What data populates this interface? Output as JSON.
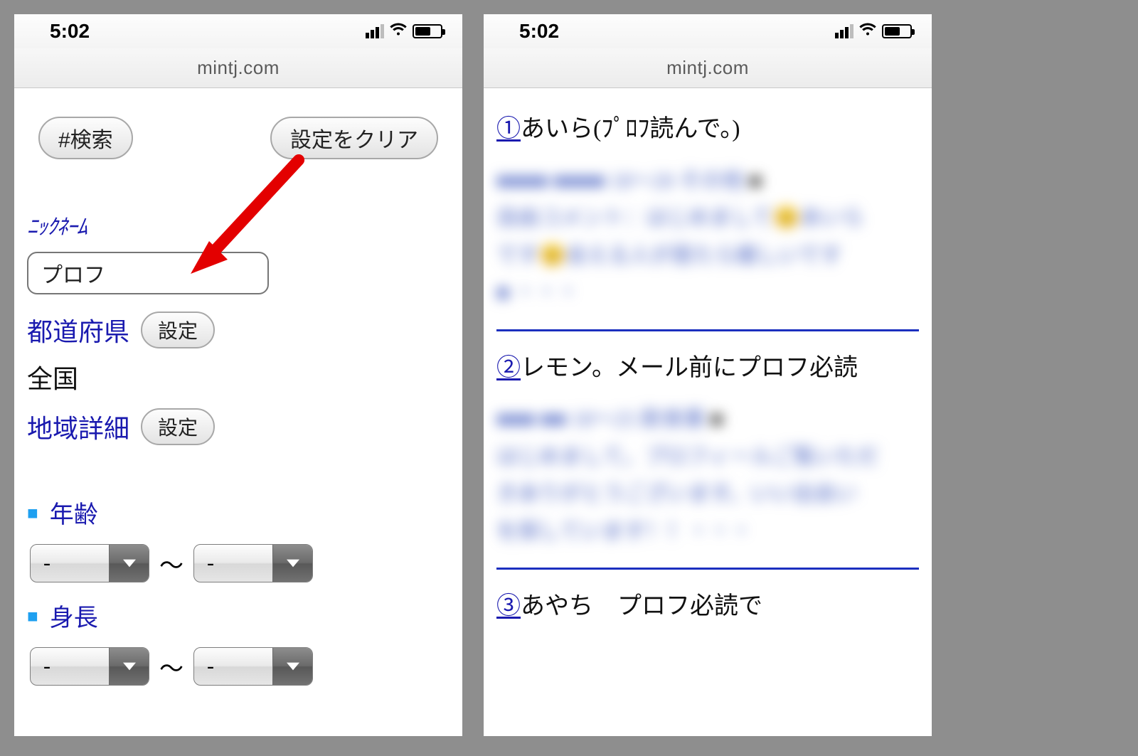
{
  "status": {
    "time": "5:02"
  },
  "url": "mintj.com",
  "left": {
    "buttons": {
      "search": "#検索",
      "clear": "設定をクリア",
      "set": "設定"
    },
    "nickname": {
      "label": "ﾆｯｸﾈｰﾑ",
      "value": "プロフ"
    },
    "prefecture": {
      "label": "都道府県",
      "value": "全国"
    },
    "region_detail_label": "地域詳細",
    "age": {
      "label": "年齢",
      "from": "-",
      "to": "-",
      "sep": "〜"
    },
    "height": {
      "label": "身長",
      "from": "-",
      "to": "-",
      "sep": "〜"
    }
  },
  "results": [
    {
      "num": "①",
      "title": "あいら(ﾌﾟﾛﾌ読んで。)"
    },
    {
      "num": "②",
      "title": "レモン。メール前にプロフ必読"
    },
    {
      "num": "③",
      "title": "あやち　プロフ必読で"
    }
  ]
}
